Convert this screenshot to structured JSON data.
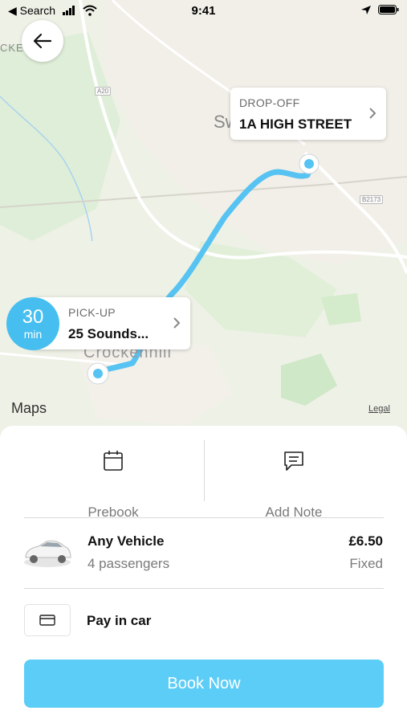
{
  "status_bar": {
    "back_app": "◀ Search",
    "time": "9:41"
  },
  "map": {
    "place_labels": [
      "CKE",
      "Sw",
      "Crockenhill"
    ],
    "road_labels": [
      "A20",
      "B2173"
    ],
    "maps_logo": "Maps",
    "legal": "Legal"
  },
  "dropoff": {
    "label": "DROP-OFF",
    "value": "1A HIGH STREET"
  },
  "pickup": {
    "label": "PICK-UP",
    "value": "25 Sounds...",
    "eta_value": "30",
    "eta_unit": "min"
  },
  "actions": {
    "prebook": "Prebook",
    "add_note": "Add Note"
  },
  "vehicle": {
    "name": "Any Vehicle",
    "passengers": "4 passengers",
    "price": "£6.50",
    "price_type": "Fixed"
  },
  "payment": {
    "label": "Pay in car"
  },
  "book_button": "Book Now",
  "colors": {
    "accent": "#46bff0",
    "route": "#56c3f2",
    "button": "#5ccdf7"
  }
}
